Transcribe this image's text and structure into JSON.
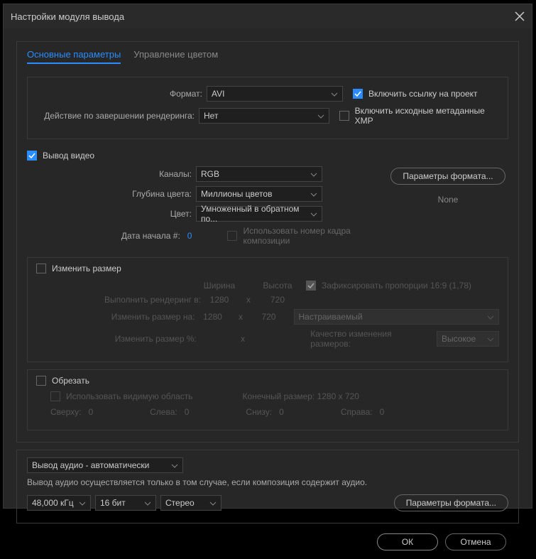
{
  "window": {
    "title": "Настройки модуля вывода"
  },
  "tabs": {
    "main": "Основные параметры",
    "color": "Управление цветом"
  },
  "top": {
    "format_label": "Формат:",
    "format_value": "AVI",
    "action_label": "Действие по завершении рендеринга:",
    "action_value": "Нет",
    "include_link": "Включить ссылку на проект",
    "include_xmp": "Включить исходные метаданные XMP"
  },
  "video": {
    "output_video": "Вывод видео",
    "channels_label": "Каналы:",
    "channels_value": "RGB",
    "depth_label": "Глубина цвета:",
    "depth_value": "Миллионы цветов",
    "color_label": "Цвет:",
    "color_value": "Умноженный в обратном по...",
    "start_label": "Дата начала #:",
    "start_value": "0",
    "use_comp_frame": "Использовать номер кадра композиции",
    "format_options": "Параметры формата...",
    "none": "None"
  },
  "resize": {
    "title": "Изменить размер",
    "width": "Ширина",
    "height": "Высота",
    "lock": "Зафиксировать пропорции 16:9 (1,78)",
    "render_at": "Выполнить рендеринг в:",
    "resize_to": "Изменить размер на:",
    "resize_pct": "Изменить размер %:",
    "w1": "1280",
    "h1": "720",
    "w2": "1280",
    "h2": "720",
    "x": "x",
    "custom": "Настраиваемый",
    "quality_label": "Качество изменения размеров:",
    "quality_value": "Высокое"
  },
  "crop": {
    "title": "Обрезать",
    "use_region": "Использовать видимую область",
    "final_size": "Конечный размер: 1280 x 720",
    "top": "Сверху:",
    "left": "Слева:",
    "bottom": "Снизу:",
    "right": "Справа:",
    "v0": "0"
  },
  "audio": {
    "mode": "Вывод аудио - автоматически",
    "help": "Вывод аудио осуществляется только в том случае, если композиция содержит аудио.",
    "rate": "48,000 кГц",
    "bits": "16 бит",
    "chan": "Стерео",
    "format_options": "Параметры формата..."
  },
  "buttons": {
    "ok": "ОК",
    "cancel": "Отмена"
  },
  "chart_data": null
}
